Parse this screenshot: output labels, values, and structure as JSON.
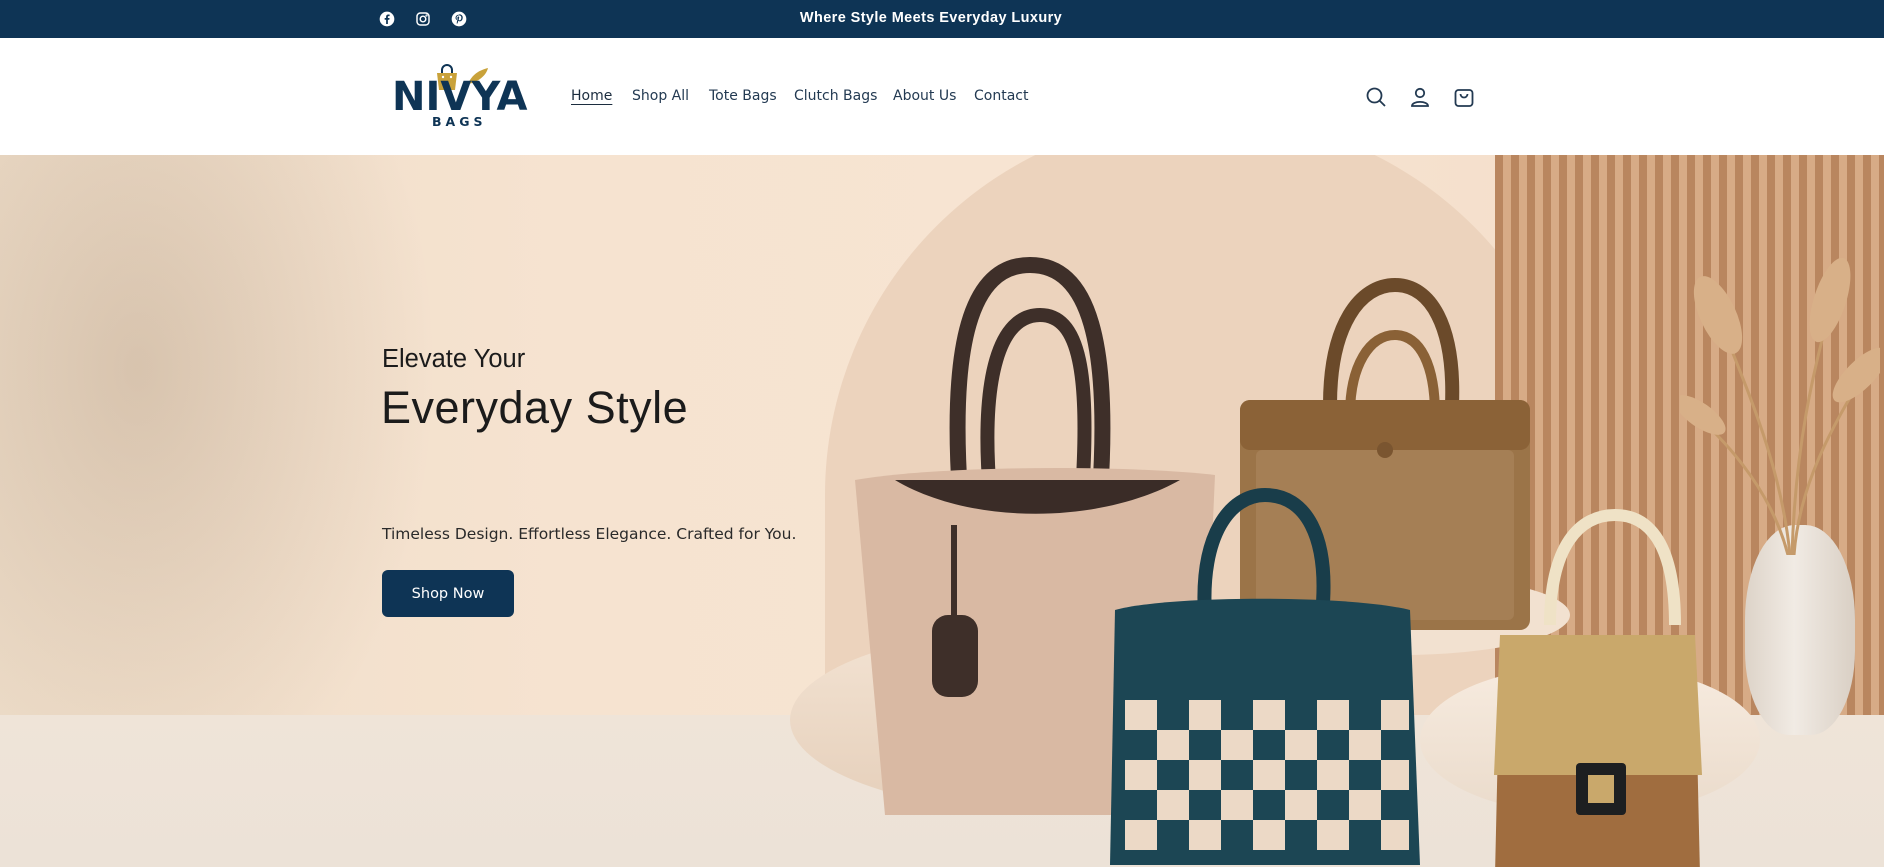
{
  "announcement": {
    "text": "Where Style Meets Everyday Luxury"
  },
  "social": [
    {
      "icon": "facebook-icon"
    },
    {
      "icon": "instagram-icon"
    },
    {
      "icon": "pinterest-icon"
    }
  ],
  "brand": {
    "logo_word": "NIVYA",
    "logo_sub": "BAGS"
  },
  "nav": {
    "items": [
      {
        "label": "Home",
        "active": true
      },
      {
        "label": "Shop All"
      },
      {
        "label": "Tote Bags"
      },
      {
        "label": "Clutch Bags"
      },
      {
        "label": "About Us"
      },
      {
        "label": "Contact"
      }
    ]
  },
  "header_icons": [
    "search-icon",
    "account-icon",
    "cart-icon"
  ],
  "hero": {
    "subtitle": "Elevate Your",
    "title": "Everyday Style",
    "tagline": "Timeless Design. Effortless Elegance. Crafted for You.",
    "cta_label": "Shop Now"
  },
  "colors": {
    "brand_navy": "#0e3455",
    "logo_gold": "#c9a23a",
    "hero_background": "#f6e3d0"
  }
}
